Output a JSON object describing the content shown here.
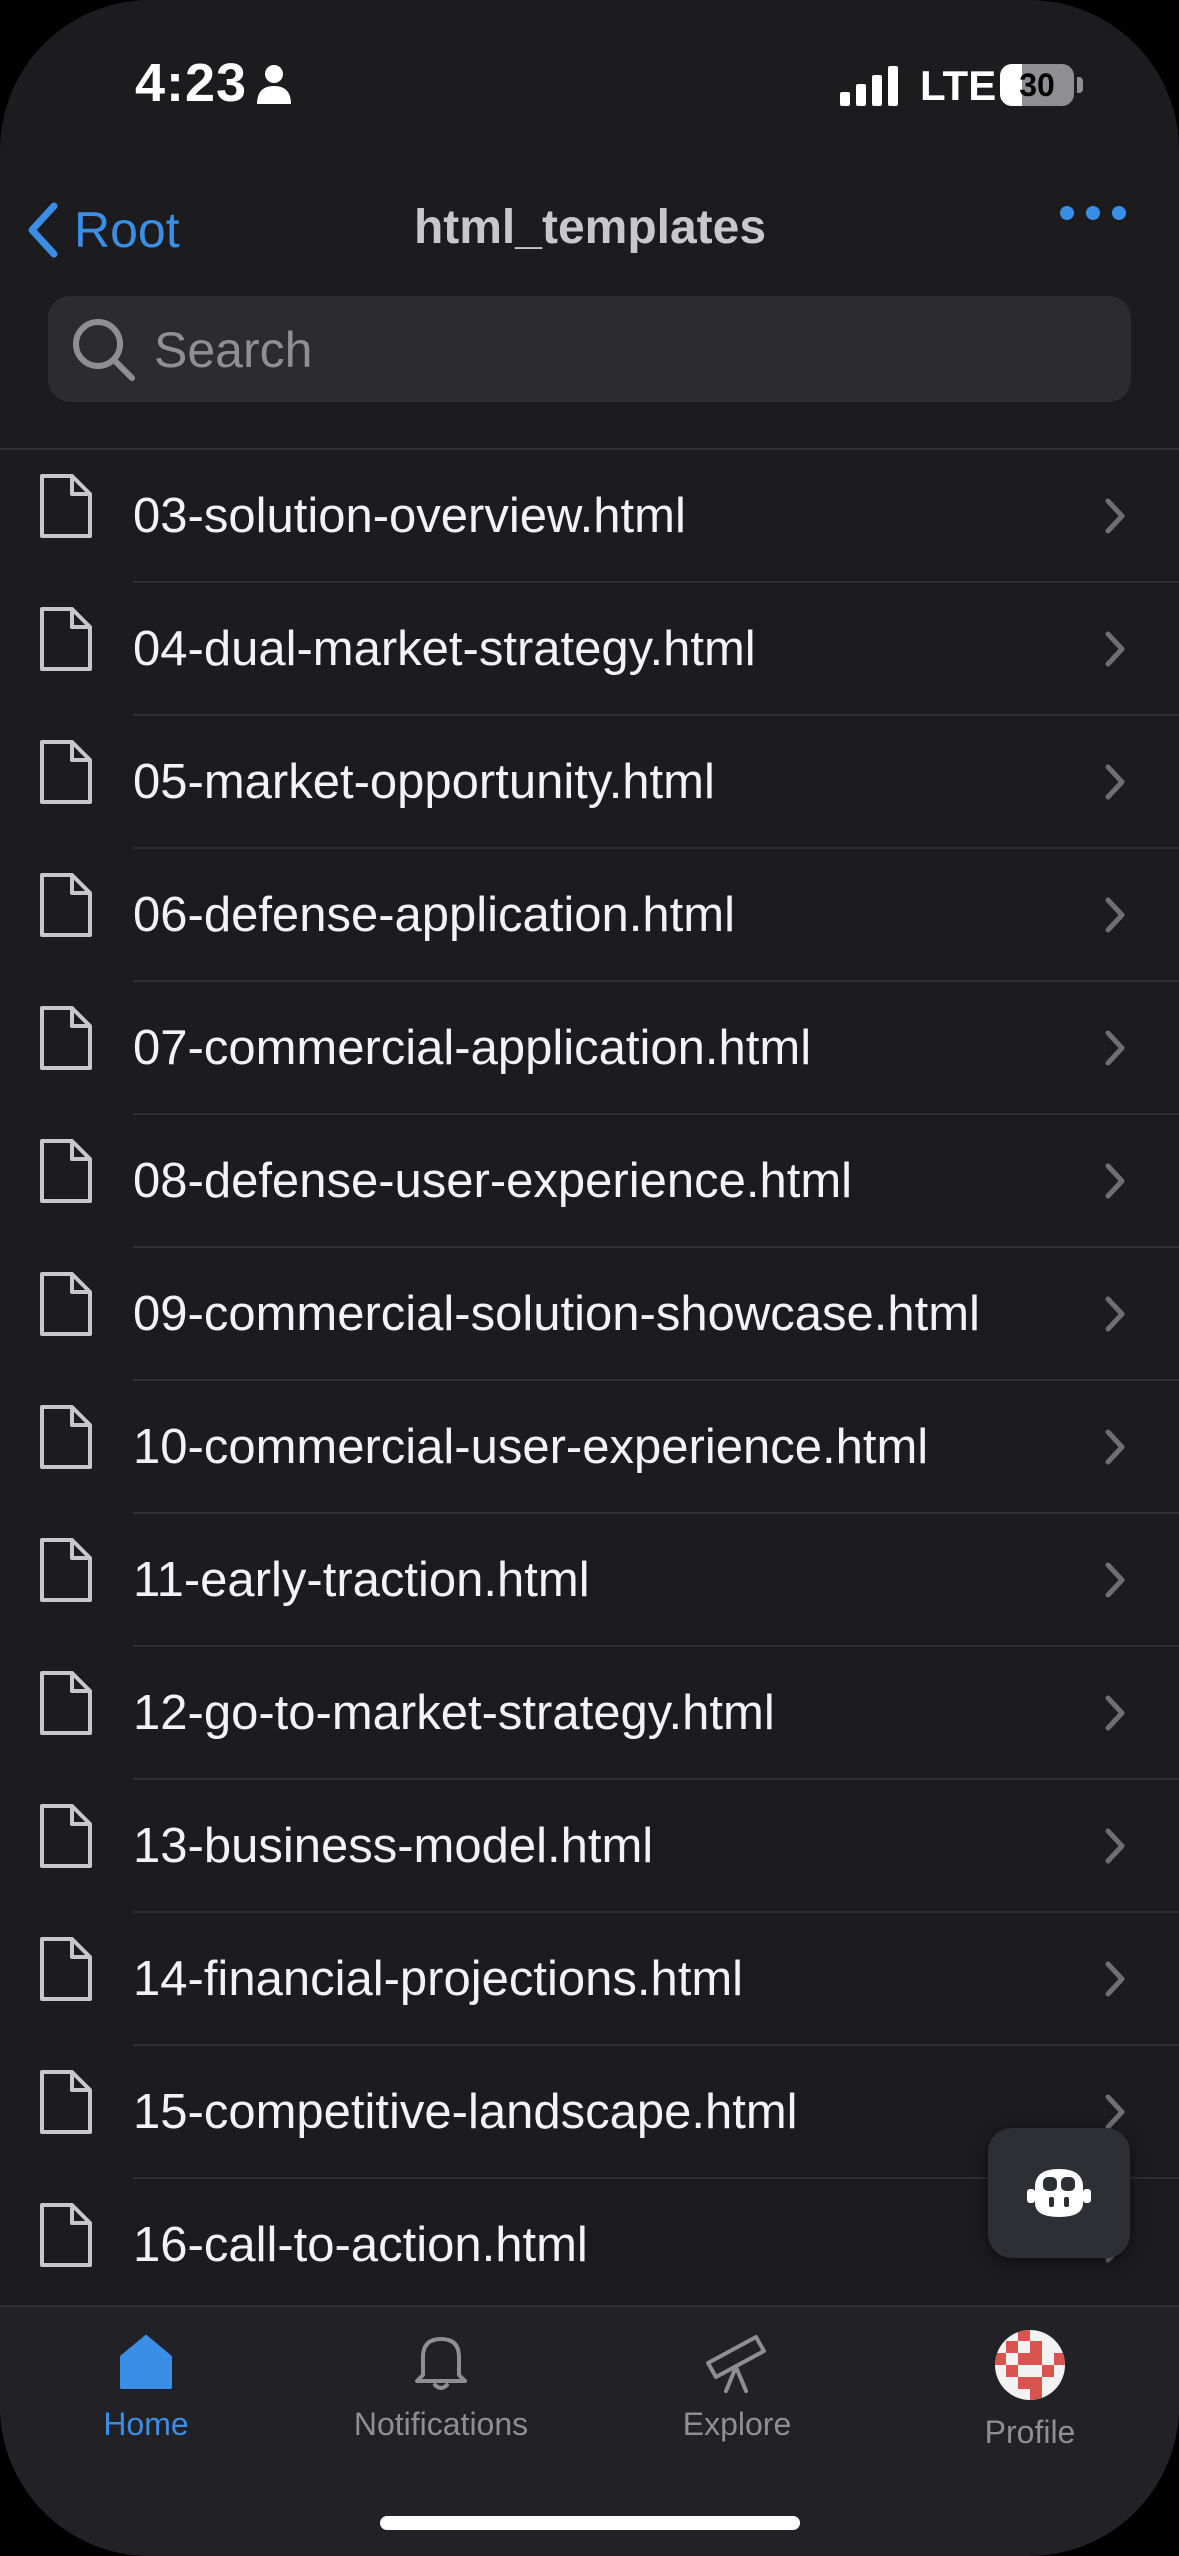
{
  "status_bar": {
    "time": "4:23",
    "network": "LTE",
    "battery": "30",
    "battery_level": 0.3
  },
  "nav": {
    "back_label": "Root",
    "title": "html_templates"
  },
  "search": {
    "placeholder": "Search"
  },
  "files": [
    "03-solution-overview.html",
    "04-dual-market-strategy.html",
    "05-market-opportunity.html",
    "06-defense-application.html",
    "07-commercial-application.html",
    "08-defense-user-experience.html",
    "09-commercial-solution-showcase.html",
    "10-commercial-user-experience.html",
    "11-early-traction.html",
    "12-go-to-market-strategy.html",
    "13-business-model.html",
    "14-financial-projections.html",
    "15-competitive-landscape.html",
    "16-call-to-action.html"
  ],
  "tabs": {
    "home": "Home",
    "notifications": "Notifications",
    "explore": "Explore",
    "profile": "Profile"
  },
  "colors": {
    "accent": "#3a8ee6",
    "background": "#1c1c1f",
    "inactive": "#8e8e93"
  }
}
